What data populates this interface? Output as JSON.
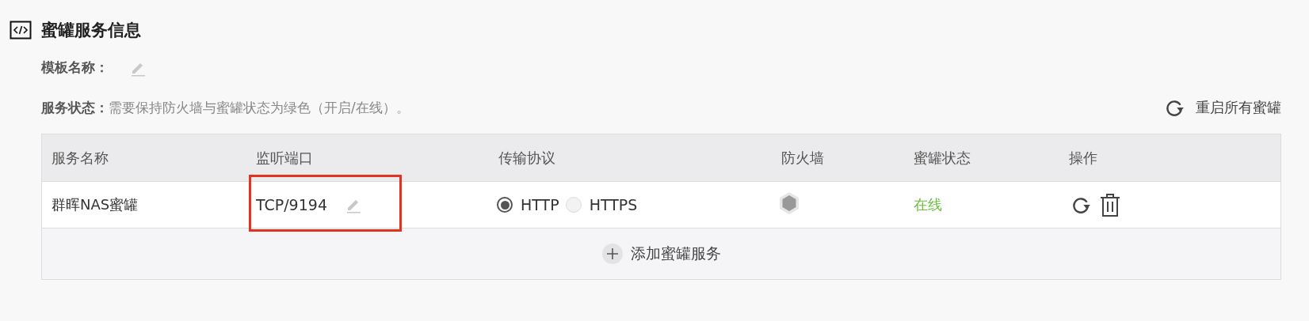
{
  "section": {
    "title": "蜜罐服务信息"
  },
  "template": {
    "label": "模板名称："
  },
  "service_status": {
    "label": "服务状态：",
    "hint": "需要保持防火墙与蜜罐状态为绿色（开启/在线）。"
  },
  "restart_all": {
    "label": "重启所有蜜罐"
  },
  "table": {
    "columns": [
      "服务名称",
      "监听端口",
      "传输协议",
      "防火墙",
      "蜜罐状态",
      "操作"
    ],
    "rows": [
      {
        "name": "群晖NAS蜜罐",
        "port": "TCP/9194",
        "port_highlighted": true,
        "protocols": [
          {
            "label": "HTTP",
            "selected": true
          },
          {
            "label": "HTTPS",
            "selected": false
          }
        ],
        "firewall_on": false,
        "status": "在线",
        "online": true
      }
    ]
  },
  "add_service": {
    "label": "添加蜜罐服务"
  }
}
